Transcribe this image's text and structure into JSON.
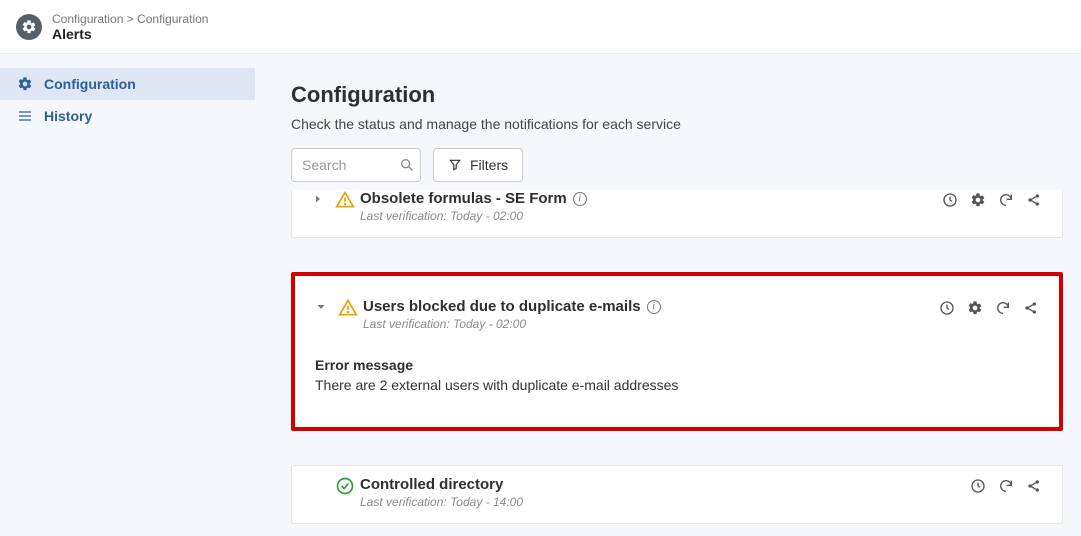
{
  "header": {
    "breadcrumb": "Configuration > Configuration",
    "title": "Alerts"
  },
  "sidebar": {
    "items": [
      {
        "label": "Configuration"
      },
      {
        "label": "History"
      }
    ]
  },
  "main": {
    "title": "Configuration",
    "description": "Check the status and manage the notifications for each service",
    "search_placeholder": "Search",
    "filters_label": "Filters"
  },
  "cards": [
    {
      "title": "Obsolete formulas - SE Form",
      "last_verification_label": "Last verification:",
      "last_verification_value": "Today - 02:00"
    },
    {
      "title": "Users blocked due to duplicate e-mails",
      "last_verification_label": "Last verification:",
      "last_verification_value": "Today - 02:00",
      "error_label": "Error message",
      "error_message": "There are 2 external users with duplicate e-mail addresses"
    },
    {
      "title": "Controlled directory",
      "last_verification_label": "Last verification:",
      "last_verification_value": "Today - 14:00"
    }
  ]
}
